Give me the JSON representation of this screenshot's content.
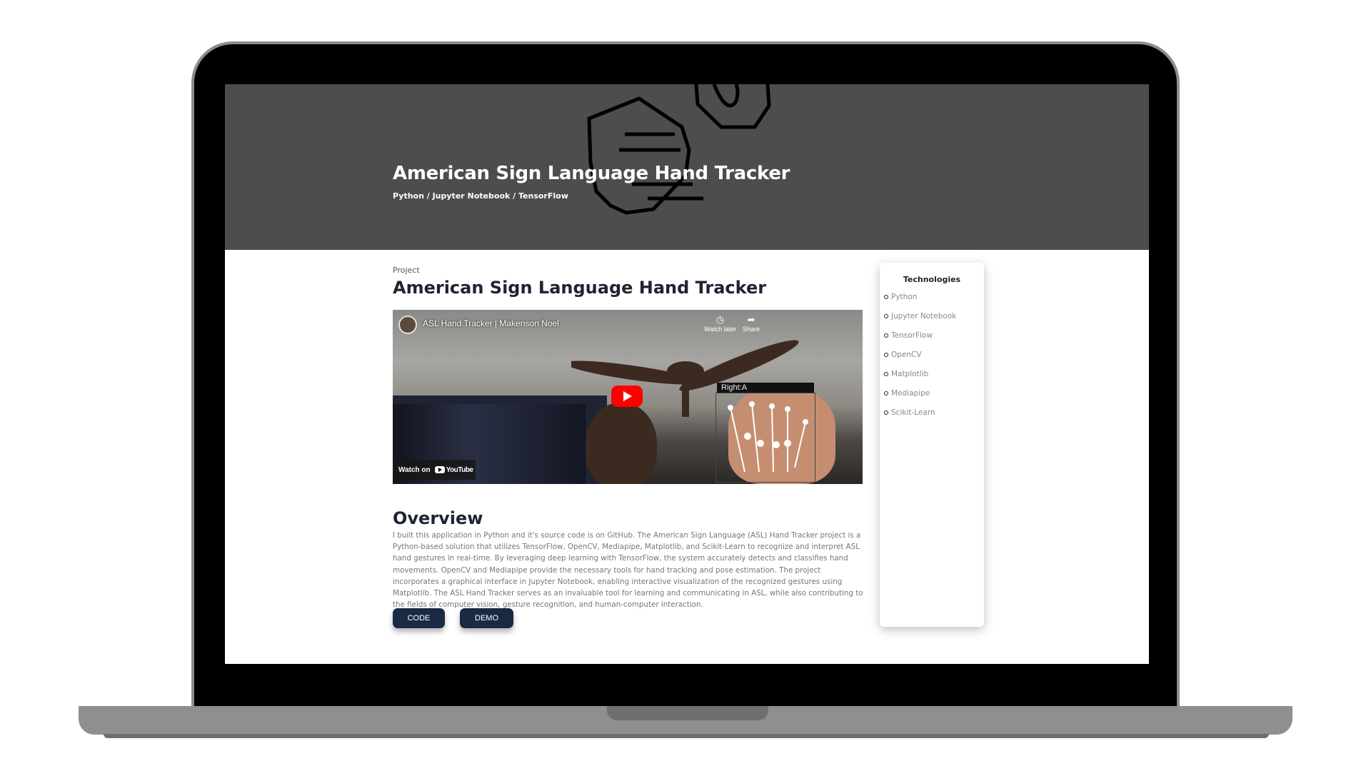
{
  "hero": {
    "title": "American Sign Language Hand Tracker",
    "subtitle": "Python / Jupyter Notebook / TensorFlow"
  },
  "main": {
    "kicker": "Project",
    "title": "American Sign Language Hand Tracker"
  },
  "video": {
    "title": "ASL Hand Tracker | Makenson Noel",
    "watch_later": "Watch later",
    "share": "Share",
    "watch_on": "Watch on",
    "youtube": "YouTube",
    "tracker_label": "Right:A"
  },
  "overview": {
    "heading": "Overview",
    "text": "I built this application in Python and it's source code is on GitHub. The American Sign Language (ASL) Hand Tracker project is a Python-based solution that utilizes TensorFlow, OpenCV, Mediapipe, Matplotlib, and Scikit-Learn to recognize and interpret ASL hand gestures in real-time. By leveraging deep learning with TensorFlow, the system accurately detects and classifies hand movements. OpenCV and Mediapipe provide the necessary tools for hand tracking and pose estimation. The project incorporates a graphical interface in Jupyter Notebook, enabling interactive visualization of the recognized gestures using Matplotlib. The ASL Hand Tracker serves as an invaluable tool for learning and communicating in ASL, while also contributing to the fields of computer vision, gesture recognition, and human-computer interaction."
  },
  "buttons": {
    "code": "CODE",
    "demo": "DEMO"
  },
  "technologies": {
    "heading": "Technologies",
    "items": [
      "Python",
      "Jupyter Notebook",
      "TensorFlow",
      "OpenCV",
      "Matplotlib",
      "Mediapipe",
      "Scikit-Learn"
    ]
  },
  "colors": {
    "hero_bg": "#4d4d4d",
    "button_bg": "#1b2a44",
    "youtube_red": "#ff0000"
  }
}
